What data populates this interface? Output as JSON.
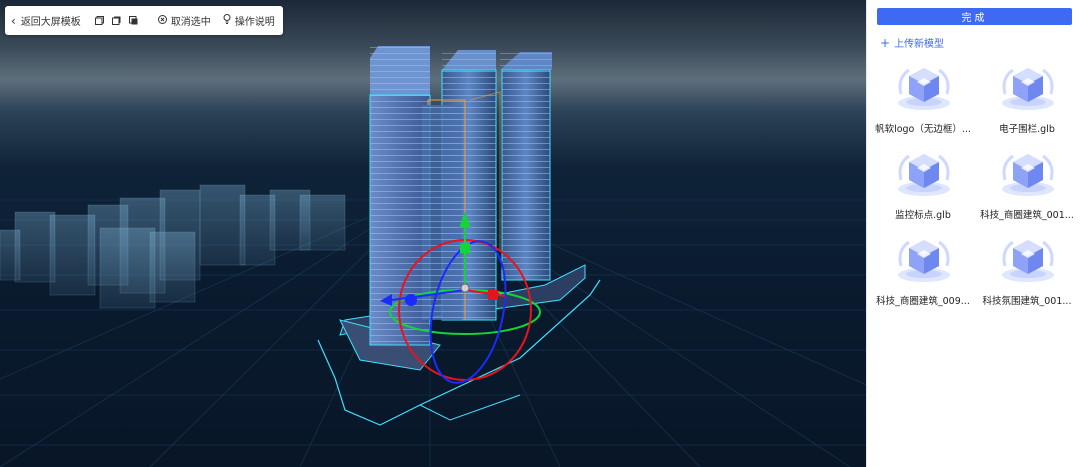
{
  "toolbar": {
    "back_label": "返回大屏模板",
    "deselect_label": "取消选中",
    "help_label": "操作说明"
  },
  "panel": {
    "done_label": "完成",
    "upload_label": "上传新模型",
    "models": [
      {
        "name": "帆软logo（无边框）..."
      },
      {
        "name": "电子围栏.glb"
      },
      {
        "name": "监控标点.glb"
      },
      {
        "name": "科技_商圈建筑_001..."
      },
      {
        "name": "科技_商圈建筑_009..."
      },
      {
        "name": "科技氛围建筑_001..."
      }
    ]
  },
  "colors": {
    "accent": "#3e6af3",
    "gizmo_x": "#e8141c",
    "gizmo_y": "#15d438",
    "gizmo_z": "#1a2bff",
    "building_edge": "#3fe0ff"
  }
}
